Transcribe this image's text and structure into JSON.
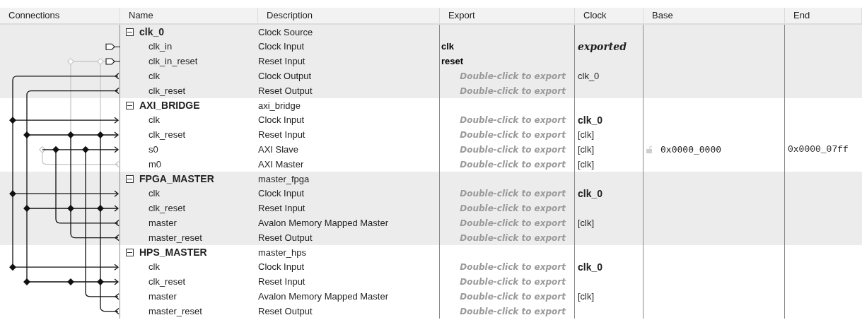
{
  "columns": [
    "Connections",
    "Name",
    "Description",
    "Export",
    "Clock",
    "Base",
    "End"
  ],
  "groups": [
    {
      "name": "clk_0",
      "description": "Clock Source",
      "expanded": true,
      "ports": [
        {
          "name": "clk_in",
          "description": "Clock Input",
          "export": {
            "kind": "exported",
            "text": "clk"
          },
          "clock": {
            "kind": "exported",
            "text": "exported"
          }
        },
        {
          "name": "clk_in_reset",
          "description": "Reset Input",
          "export": {
            "kind": "exported",
            "text": "reset"
          }
        },
        {
          "name": "clk",
          "description": "Clock Output",
          "export": {
            "kind": "hint",
            "text": "Double-click to export"
          },
          "clock": {
            "kind": "plain",
            "text": "clk_0"
          }
        },
        {
          "name": "clk_reset",
          "description": "Reset Output",
          "export": {
            "kind": "hint",
            "text": "Double-click to export"
          }
        }
      ]
    },
    {
      "name": "AXI_BRIDGE",
      "description": "axi_bridge",
      "expanded": true,
      "ports": [
        {
          "name": "clk",
          "description": "Clock Input",
          "export": {
            "kind": "hint",
            "text": "Double-click to export"
          },
          "clock": {
            "kind": "bold",
            "text": "clk_0"
          }
        },
        {
          "name": "clk_reset",
          "description": "Reset Input",
          "export": {
            "kind": "hint",
            "text": "Double-click to export"
          },
          "clock": {
            "kind": "plain",
            "text": "[clk]"
          }
        },
        {
          "name": "s0",
          "description": "AXI Slave",
          "export": {
            "kind": "hint",
            "text": "Double-click to export"
          },
          "clock": {
            "kind": "plain",
            "text": "[clk]"
          },
          "base": "0x0000_0000",
          "end": "0x0000_07ff"
        },
        {
          "name": "m0",
          "description": "AXI Master",
          "export": {
            "kind": "hint",
            "text": "Double-click to export"
          },
          "clock": {
            "kind": "plain",
            "text": "[clk]"
          }
        }
      ]
    },
    {
      "name": "FPGA_MASTER",
      "description": "master_fpga",
      "expanded": true,
      "ports": [
        {
          "name": "clk",
          "description": "Clock Input",
          "export": {
            "kind": "hint",
            "text": "Double-click to export"
          },
          "clock": {
            "kind": "bold",
            "text": "clk_0"
          }
        },
        {
          "name": "clk_reset",
          "description": "Reset Input",
          "export": {
            "kind": "hint",
            "text": "Double-click to export"
          }
        },
        {
          "name": "master",
          "description": "Avalon Memory Mapped Master",
          "export": {
            "kind": "hint",
            "text": "Double-click to export"
          },
          "clock": {
            "kind": "plain",
            "text": "[clk]"
          }
        },
        {
          "name": "master_reset",
          "description": "Reset Output",
          "export": {
            "kind": "hint",
            "text": "Double-click to export"
          }
        }
      ]
    },
    {
      "name": "HPS_MASTER",
      "description": "master_hps",
      "expanded": true,
      "ports": [
        {
          "name": "clk",
          "description": "Clock Input",
          "export": {
            "kind": "hint",
            "text": "Double-click to export"
          },
          "clock": {
            "kind": "bold",
            "text": "clk_0"
          }
        },
        {
          "name": "clk_reset",
          "description": "Reset Input",
          "export": {
            "kind": "hint",
            "text": "Double-click to export"
          }
        },
        {
          "name": "master",
          "description": "Avalon Memory Mapped Master",
          "export": {
            "kind": "hint",
            "text": "Double-click to export"
          },
          "clock": {
            "kind": "plain",
            "text": "[clk]"
          }
        },
        {
          "name": "master_reset",
          "description": "Reset Output",
          "export": {
            "kind": "hint",
            "text": "Double-click to export"
          }
        }
      ]
    }
  ]
}
